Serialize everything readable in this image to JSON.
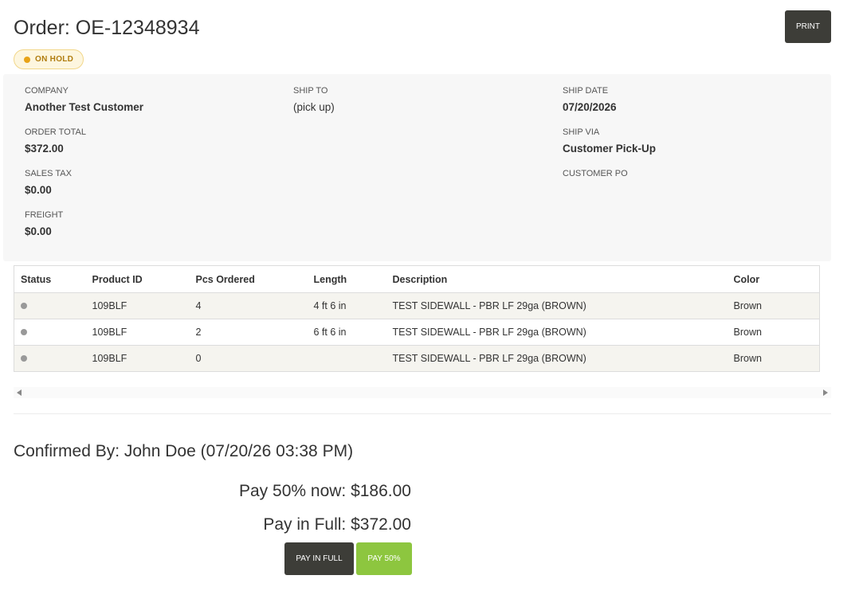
{
  "header": {
    "title": "Order: OE-12348934",
    "print_label": "PRINT",
    "status_badge": "ON HOLD"
  },
  "colors": {
    "badge_dot": "#e8a317",
    "badge_text": "#b07c0e",
    "dark_button": "#3d3d38",
    "green_button": "#8dc63f",
    "row_status_dot": "#999999"
  },
  "info": {
    "company_label": "COMPANY",
    "company_value": "Another Test Customer",
    "order_total_label": "ORDER TOTAL",
    "order_total_value": "$372.00",
    "sales_tax_label": "SALES TAX",
    "sales_tax_value": "$0.00",
    "freight_label": "FREIGHT",
    "freight_value": "$0.00",
    "ship_to_label": "SHIP TO",
    "ship_to_value": "(pick up)",
    "ship_date_label": "SHIP DATE",
    "ship_date_value": "07/20/2026",
    "ship_via_label": "SHIP VIA",
    "ship_via_value": "Customer Pick-Up",
    "customer_po_label": "CUSTOMER PO",
    "customer_po_value": ""
  },
  "table": {
    "headers": [
      "Status",
      "Product ID",
      "Pcs Ordered",
      "Length",
      "Description",
      "Color"
    ],
    "rows": [
      {
        "status_icon": "status-dot-icon",
        "product_id": "109BLF",
        "pcs_ordered": "4",
        "length": "4 ft 6 in",
        "description": "TEST SIDEWALL - PBR LF 29ga (BROWN)",
        "color": "Brown"
      },
      {
        "status_icon": "status-dot-icon",
        "product_id": "109BLF",
        "pcs_ordered": "2",
        "length": "6 ft 6 in",
        "description": "TEST SIDEWALL - PBR LF 29ga (BROWN)",
        "color": "Brown"
      },
      {
        "status_icon": "status-dot-icon",
        "product_id": "109BLF",
        "pcs_ordered": "0",
        "length": "",
        "description": "TEST SIDEWALL - PBR LF 29ga (BROWN)",
        "color": "Brown"
      }
    ]
  },
  "footer": {
    "confirmed_by": "Confirmed By: John Doe (07/20/26 03:38 PM)",
    "pay_half_text": "Pay 50% now: $186.00",
    "pay_full_text": "Pay in Full: $372.00",
    "pay_full_button": "PAY IN FULL",
    "pay_half_button": "PAY 50%"
  }
}
